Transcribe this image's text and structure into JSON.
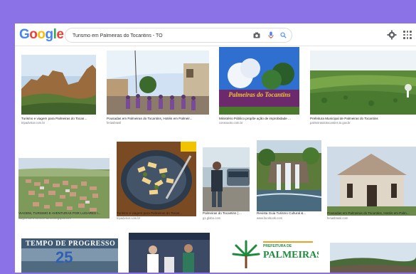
{
  "browser": {
    "logo": [
      "G",
      "o",
      "o",
      "g",
      "l",
      "e"
    ],
    "logo_colors": [
      "#4285f4",
      "#ea4335",
      "#fbbc05",
      "#4285f4",
      "#34a853",
      "#ea4335"
    ],
    "search_value": "Turismo em Palmeiras do Tocantins - TO"
  },
  "results": [
    {
      "caption": "Turismo e viagem para Palmeiras do Tocan...",
      "source": "tripadvisor.com.br"
    },
    {
      "caption": "Pousadas em Palmeiras do Tocantins, Hotéis em Palmeir...",
      "source": "feriasbrasil"
    },
    {
      "caption": "Ministério Público propõe ação de improbidade ...",
      "source": "conexaoto.com.br"
    },
    {
      "caption": "Prefeitura Municipal de Palmeiras do Tocantins",
      "source": "palmeirasdotocantins.to.gov.br"
    },
    {
      "caption": "VIAGEM, TURISMO E AVENTURAS POR LUGARES I...",
      "source": "viagemturismoeaventuras.blogspot.com"
    },
    {
      "caption": "Turismo e viagem para Palmeiras do Tocan...",
      "source": "tripadvisor.com.br"
    },
    {
      "caption": "Palmeiras do Tocantins | ...",
      "source": "g1.globo.com"
    },
    {
      "caption": "Revista Guia Turismo Cultural &...",
      "source": "www.facebook.com"
    },
    {
      "caption": "Pousadas em Palmeiras do Tocantins, Hotéis em Palm...",
      "source": "feriasbrasil.com"
    }
  ],
  "image_texts": {
    "palmeiras_sign": "Palmeiras do Tocantins",
    "progress_banner": "TEMPO DE PROGRESSO",
    "progress_number": "25",
    "prefeitura_small": "PREFEITURA DE",
    "palmeiras_logo": "PALMEIRAS"
  },
  "colors": {
    "frame": "#8b72e6",
    "mic": "#4285f4",
    "camera": "#5f6368"
  },
  "icons": [
    "camera-icon",
    "microphone-icon",
    "search-icon",
    "gear-icon",
    "apps-grid-icon"
  ]
}
